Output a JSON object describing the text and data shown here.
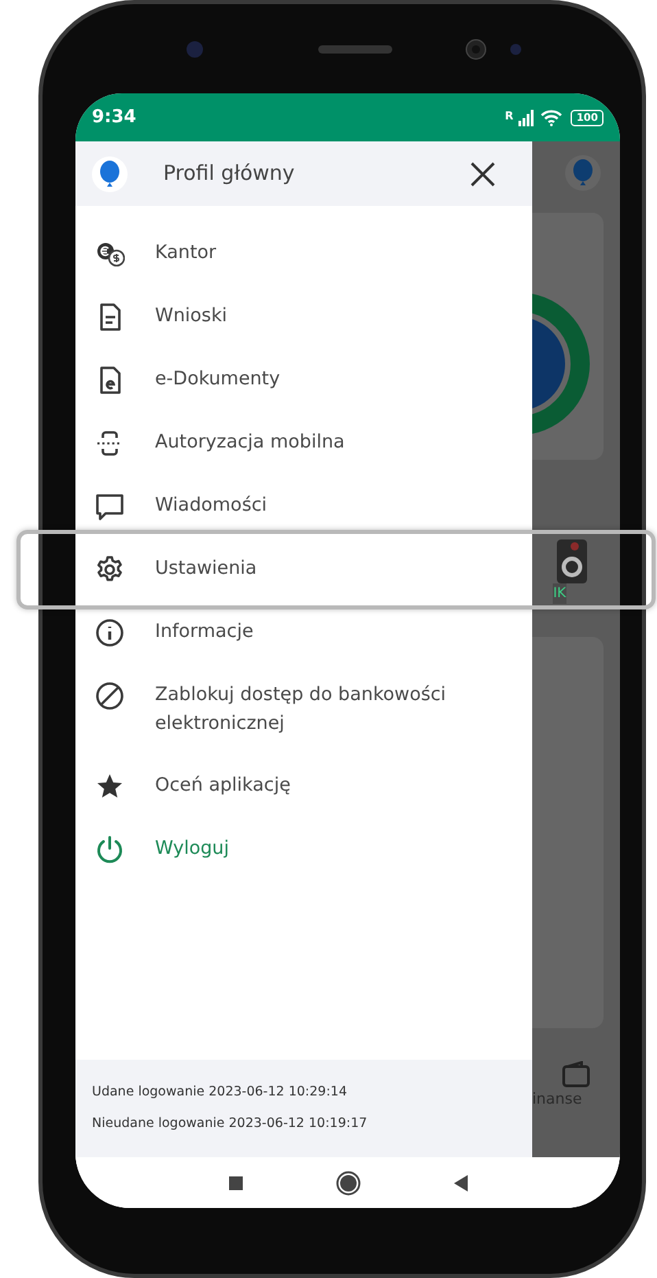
{
  "status_bar": {
    "time": "9:34",
    "signal_label": "R",
    "battery": "100"
  },
  "drawer": {
    "title": "Profil główny",
    "items": [
      {
        "label": "Kantor",
        "kind": "normal",
        "highlighted": false
      },
      {
        "label": "Wnioski",
        "kind": "normal",
        "highlighted": false
      },
      {
        "label": "e-Dokumenty",
        "kind": "normal",
        "highlighted": false
      },
      {
        "label": "Autoryzacja mobilna",
        "kind": "normal",
        "highlighted": false
      },
      {
        "label": "Wiadomości",
        "kind": "normal",
        "highlighted": false
      },
      {
        "label": "Ustawienia",
        "kind": "normal",
        "highlighted": true
      },
      {
        "label": "Informacje",
        "kind": "normal",
        "highlighted": false
      },
      {
        "label": "Zablokuj dostęp do bankowości elektronicznej",
        "kind": "normal",
        "highlighted": false
      },
      {
        "label": "Oceń aplikację",
        "kind": "normal",
        "highlighted": false
      },
      {
        "label": "Wyloguj",
        "kind": "logout",
        "highlighted": false
      }
    ],
    "footer": [
      "Udane logowanie 2023-06-12 10:29:14",
      "Nieudane logowanie 2023-06-12 10:19:17"
    ]
  },
  "background": {
    "texts": [
      "IK",
      "inanse"
    ]
  }
}
